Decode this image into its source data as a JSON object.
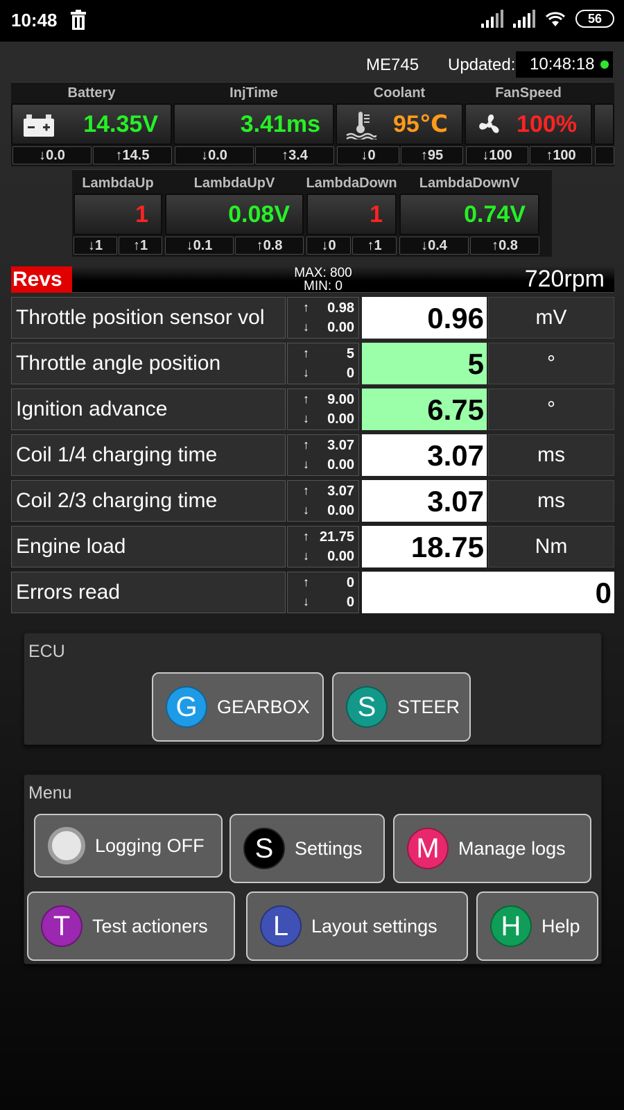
{
  "status_bar": {
    "time": "10:48",
    "battery": "56"
  },
  "header": {
    "ecu": "ME745",
    "updated_label": "Updated:",
    "updated_time": "10:48:18"
  },
  "gauges_row1": [
    {
      "title": "Battery",
      "value": "14.35V",
      "color": "#26f026",
      "icon": "battery-icon",
      "min": "0.0",
      "max": "14.5"
    },
    {
      "title": "InjTime",
      "value": "3.41ms",
      "color": "#26f026",
      "icon": "",
      "min": "0.0",
      "max": "3.4"
    },
    {
      "title": "Coolant",
      "value": "95℃",
      "color": "#ff9b1a",
      "icon": "coolant-temperature-icon",
      "min": "0",
      "max": "95"
    },
    {
      "title": "FanSpeed",
      "value": "100%",
      "color": "#ff2323",
      "icon": "fan-icon",
      "min": "100",
      "max": "100"
    }
  ],
  "gauges_row2": [
    {
      "title": "LambdaUp",
      "value": "1",
      "color": "#ff2323",
      "min": "1",
      "max": "1"
    },
    {
      "title": "LambdaUpV",
      "value": "0.08V",
      "color": "#26f026",
      "min": "0.1",
      "max": "0.8"
    },
    {
      "title": "LambdaDown",
      "value": "1",
      "color": "#ff2323",
      "min": "0",
      "max": "1"
    },
    {
      "title": "LambdaDownV",
      "value": "0.74V",
      "color": "#26f026",
      "min": "0.4",
      "max": "0.8"
    }
  ],
  "revs": {
    "label": "Revs",
    "max": "MAX: 800",
    "min": "MIN: 0",
    "value": "720rpm"
  },
  "parameters": [
    {
      "name": "Throttle position sensor vol",
      "max": "0.98",
      "min": "0.00",
      "value": "0.96",
      "unit": "mV",
      "highlight": false
    },
    {
      "name": "Throttle angle position",
      "max": "5",
      "min": "0",
      "value": "5",
      "unit": "°",
      "highlight": true
    },
    {
      "name": "Ignition advance",
      "max": "9.00",
      "min": "0.00",
      "value": "6.75",
      "unit": "°",
      "highlight": true
    },
    {
      "name": "Coil 1/4 charging time",
      "max": "3.07",
      "min": "0.00",
      "value": "3.07",
      "unit": "ms",
      "highlight": false
    },
    {
      "name": "Coil 2/3 charging time",
      "max": "3.07",
      "min": "0.00",
      "value": "3.07",
      "unit": "ms",
      "highlight": false
    },
    {
      "name": "Engine load",
      "max": "21.75",
      "min": "0.00",
      "value": "18.75",
      "unit": "Nm",
      "highlight": false
    },
    {
      "name": "Errors read",
      "max": "0",
      "min": "0",
      "value": "0",
      "unit": "",
      "highlight": false
    }
  ],
  "ecu_panel": {
    "title": "ECU",
    "buttons": [
      {
        "letter": "G",
        "label": "GEARBOX",
        "color": "#1e9be6"
      },
      {
        "letter": "S",
        "label": "STEER",
        "color": "#12998a"
      }
    ]
  },
  "menu_panel": {
    "title": "Menu",
    "buttons": [
      {
        "letter": "",
        "label": "Logging OFF",
        "color": "#e6e6e6"
      },
      {
        "letter": "S",
        "label": "Settings",
        "color": "#000000"
      },
      {
        "letter": "M",
        "label": "Manage logs",
        "color": "#e8286c"
      },
      {
        "letter": "T",
        "label": "Test actioners",
        "color": "#9c27b0"
      },
      {
        "letter": "L",
        "label": "Layout settings",
        "color": "#3f51b5"
      },
      {
        "letter": "H",
        "label": "Help",
        "color": "#0f9d58"
      }
    ]
  }
}
